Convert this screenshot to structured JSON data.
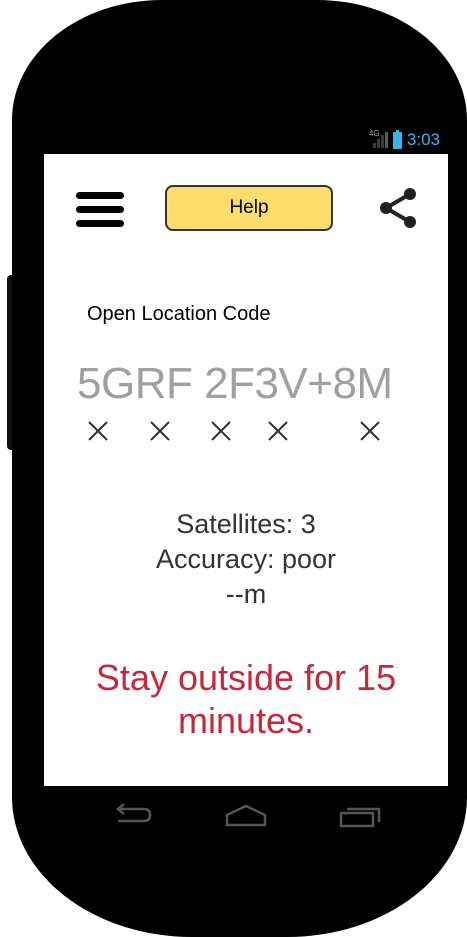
{
  "status_bar": {
    "time": "3:03",
    "network_label": "4G",
    "icons": [
      "signal-icon",
      "battery-icon"
    ],
    "accent_color": "#33b5e5"
  },
  "toolbar": {
    "menu_icon": "hamburger-menu-icon",
    "help_label": "Help",
    "share_icon": "share-icon"
  },
  "location": {
    "label": "Open Location Code",
    "code_part1": "5GRF",
    "code_part2": "2F3V+8M",
    "digit_markers": [
      "×",
      "×",
      "×",
      "×",
      "×"
    ]
  },
  "gps": {
    "satellites": "Satellites: 3",
    "accuracy": "Accuracy: poor",
    "distance": "--m"
  },
  "warning": {
    "text": "Stay outside for 15 minutes.",
    "color": "#c7273a"
  },
  "nav_bar": {
    "icons": [
      "back-icon",
      "home-icon",
      "recent-apps-icon"
    ]
  }
}
